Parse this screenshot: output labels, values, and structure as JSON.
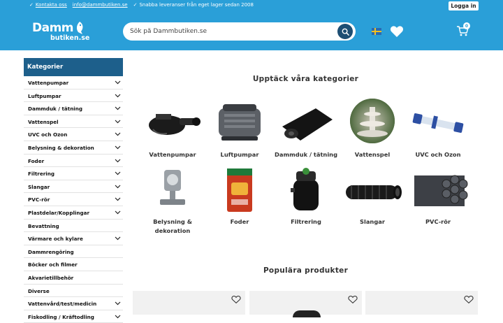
{
  "topbar": {
    "contact_label": "Kontakta oss",
    "email_label": "info@dammbutiken.se",
    "delivery_text": "Snabba leveranser från eget lager sedan 2008",
    "login_label": "Logga in"
  },
  "header": {
    "logo_line1": "Damm",
    "logo_line2": "butiken.se",
    "search_placeholder": "Sök på Dammbutiken.se",
    "cart_count": "0",
    "brand_color": "#2a9fd8"
  },
  "sidebar": {
    "title": "Kategorier",
    "items": [
      {
        "label": "Vattenpumpar",
        "has_children": true
      },
      {
        "label": "Luftpumpar",
        "has_children": true
      },
      {
        "label": "Dammduk / tätning",
        "has_children": true
      },
      {
        "label": "Vattenspel",
        "has_children": true
      },
      {
        "label": "UVC och Ozon",
        "has_children": true
      },
      {
        "label": "Belysning & dekoration",
        "has_children": true
      },
      {
        "label": "Foder",
        "has_children": true
      },
      {
        "label": "Filtrering",
        "has_children": true
      },
      {
        "label": "Slangar",
        "has_children": true
      },
      {
        "label": "PVC-rör",
        "has_children": true
      },
      {
        "label": "Plastdelar/Kopplingar",
        "has_children": true
      },
      {
        "label": "Bevattning",
        "has_children": false
      },
      {
        "label": "Värmare och kylare",
        "has_children": true
      },
      {
        "label": "Dammrengöring",
        "has_children": false
      },
      {
        "label": "Böcker och filmer",
        "has_children": false
      },
      {
        "label": "Akvarietillbehör",
        "has_children": false
      },
      {
        "label": "Diverse",
        "has_children": false
      },
      {
        "label": "Vattenvård/test/medicin",
        "has_children": true
      },
      {
        "label": "Fiskodling / Kräftodling",
        "has_children": true
      }
    ]
  },
  "main": {
    "categories_title": "Upptäck våra kategorier",
    "categories": [
      {
        "label": "Vattenpumpar",
        "icon": "water-pump-image"
      },
      {
        "label": "Luftpumpar",
        "icon": "air-pump-image"
      },
      {
        "label": "Dammduk / tätning",
        "icon": "pond-liner-image"
      },
      {
        "label": "Vattenspel",
        "icon": "fountain-image"
      },
      {
        "label": "UVC och Ozon",
        "icon": "uvc-lamp-image"
      },
      {
        "label": "Belysning & dekoration",
        "icon": "pond-light-image"
      },
      {
        "label": "Foder",
        "icon": "fish-food-image"
      },
      {
        "label": "Filtrering",
        "icon": "pond-filter-image"
      },
      {
        "label": "Slangar",
        "icon": "hose-image"
      },
      {
        "label": "PVC-rör",
        "icon": "pvc-pipes-image"
      }
    ],
    "popular_title": "Populära produkter"
  }
}
